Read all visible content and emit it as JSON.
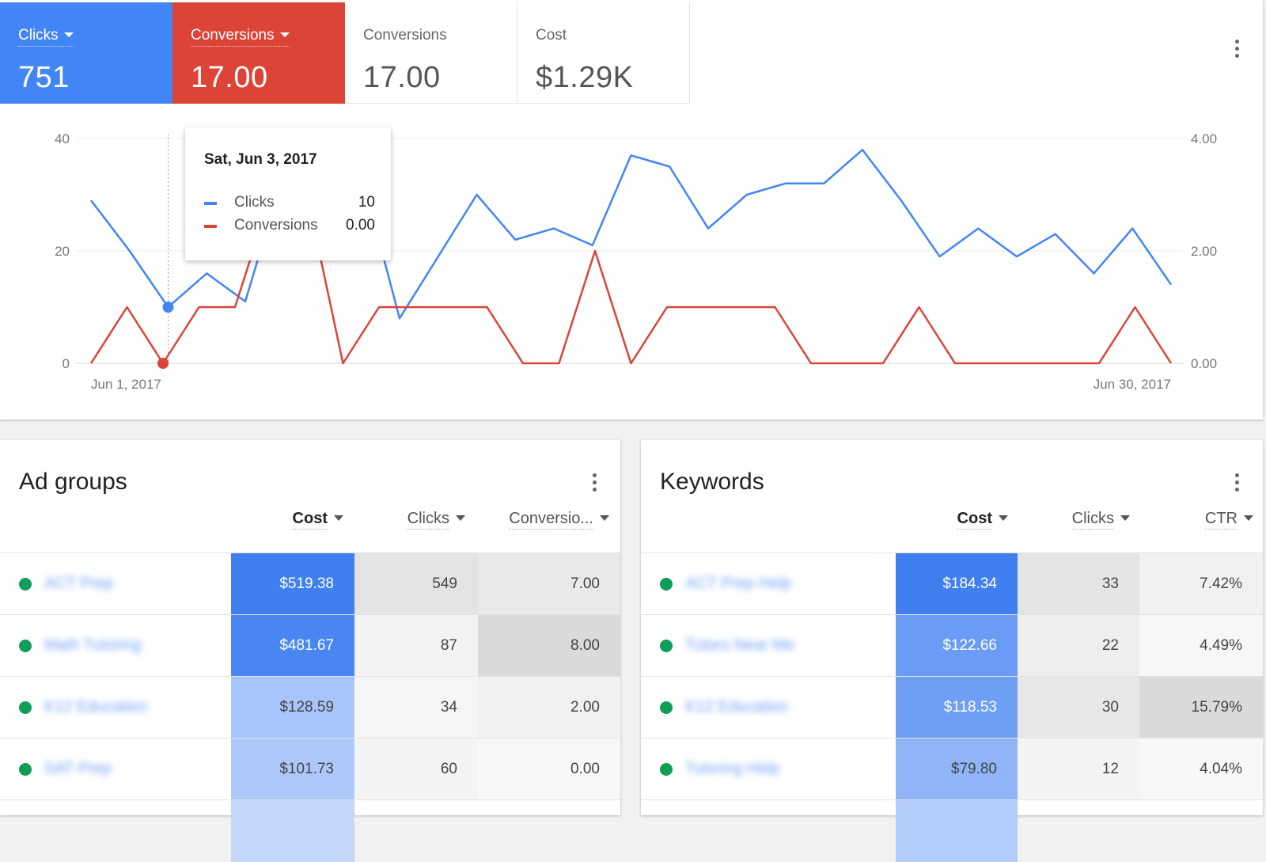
{
  "overview": {
    "tiles": [
      {
        "label": "Clicks",
        "value": "751",
        "color": "#4285f4",
        "selected": true
      },
      {
        "label": "Conversions",
        "value": "17.00",
        "color": "#db4437",
        "selected": true
      },
      {
        "label": "Conversions",
        "value": "17.00",
        "selected": false
      },
      {
        "label": "Cost",
        "value": "$1.29K",
        "selected": false
      }
    ]
  },
  "chart_data": {
    "type": "line",
    "x_start_label": "Jun 1, 2017",
    "x_end_label": "Jun 30, 2017",
    "left_ticks": [
      "0",
      "20",
      "40"
    ],
    "right_ticks": [
      "0.00",
      "2.00",
      "4.00"
    ],
    "ylim_left": [
      0,
      40
    ],
    "ylim_right": [
      0,
      4
    ],
    "series": [
      {
        "name": "Clicks",
        "axis": "left",
        "color": "#4285f4",
        "values": [
          29,
          20,
          10,
          16,
          11,
          34,
          34,
          34,
          8,
          19,
          30,
          22,
          24,
          21,
          37,
          35,
          24,
          30,
          32,
          32,
          38,
          29,
          19,
          24,
          19,
          23,
          16,
          24,
          14
        ]
      },
      {
        "name": "Conversions",
        "axis": "right",
        "color": "#db4437",
        "values": [
          0,
          1,
          0,
          1,
          1,
          3,
          3,
          0,
          1,
          1,
          1,
          1,
          0,
          0,
          2,
          0,
          1,
          1,
          1,
          1,
          0,
          0,
          0,
          1,
          0,
          0,
          0,
          0,
          0,
          1,
          0
        ]
      }
    ],
    "highlight_index": 2
  },
  "tooltip": {
    "date": "Sat, Jun 3, 2017",
    "rows": [
      {
        "name": "Clicks",
        "value": "10",
        "color": "#4285f4"
      },
      {
        "name": "Conversions",
        "value": "0.00",
        "color": "#db4437"
      }
    ]
  },
  "ad_groups": {
    "title": "Ad groups",
    "columns": [
      "Cost",
      "Clicks",
      "Conversio..."
    ],
    "rows": [
      {
        "name": "ACT Prep",
        "cost": "$519.38",
        "clicks": "549",
        "conv": "7.00"
      },
      {
        "name": "Math Tutoring",
        "cost": "$481.67",
        "clicks": "87",
        "conv": "8.00"
      },
      {
        "name": "K12 Education",
        "cost": "$128.59",
        "clicks": "34",
        "conv": "2.00"
      },
      {
        "name": "SAT Prep",
        "cost": "$101.73",
        "clicks": "60",
        "conv": "0.00"
      }
    ]
  },
  "keywords": {
    "title": "Keywords",
    "columns": [
      "Cost",
      "Clicks",
      "CTR"
    ],
    "rows": [
      {
        "name": "ACT Prep Help",
        "cost": "$184.34",
        "clicks": "33",
        "ctr": "7.42%"
      },
      {
        "name": "Tutors Near Me",
        "cost": "$122.66",
        "clicks": "22",
        "ctr": "4.49%"
      },
      {
        "name": "K12 Education",
        "cost": "$118.53",
        "clicks": "30",
        "ctr": "15.79%"
      },
      {
        "name": "Tutoring Help",
        "cost": "$79.80",
        "clicks": "12",
        "ctr": "4.04%"
      }
    ]
  }
}
